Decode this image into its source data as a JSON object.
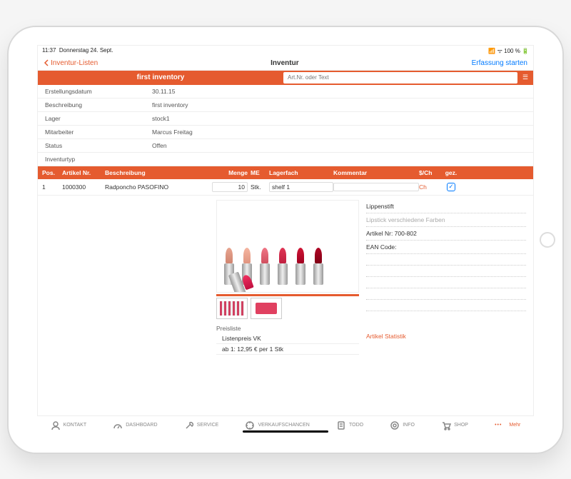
{
  "status_bar": {
    "time": "11:37",
    "date": "Donnerstag 24. Sept.",
    "battery": "100 %"
  },
  "nav": {
    "back": "Inventur-Listen",
    "title": "Inventur",
    "action": "Erfassung starten"
  },
  "title_row": {
    "label": "first inventory",
    "search_placeholder": "Art.Nr. oder Text"
  },
  "info": [
    {
      "label": "Erstellungsdatum",
      "value": "30.11.15"
    },
    {
      "label": "Beschreibung",
      "value": "first inventory"
    },
    {
      "label": "Lager",
      "value": "stock1"
    },
    {
      "label": "Mitarbeiter",
      "value": "Marcus Freitag"
    },
    {
      "label": "Status",
      "value": "Offen"
    },
    {
      "label": "Inventurtyp",
      "value": ""
    }
  ],
  "grid": {
    "headers": {
      "pos": "Pos.",
      "art": "Artikel Nr.",
      "desc": "Beschreibung",
      "menge": "Menge",
      "me": "ME",
      "lager": "Lagerfach",
      "komm": "Kommentar",
      "sch": "$/Ch",
      "gez": "gez."
    },
    "row": {
      "pos": "1",
      "art": "1000300",
      "desc": "Radponcho PASOFINO",
      "menge": "10",
      "me": "Stk.",
      "lager": "shelf 1",
      "komm": "",
      "sch": "Ch",
      "gez": true
    }
  },
  "detail": {
    "name": "Lippenstift",
    "sub": "Lipstick verschiedene Farben",
    "artnr": "Artikel Nr: 700-802",
    "ean": "EAN Code:",
    "stat_link": "Artikel Statistik",
    "pricelist": {
      "title": "Preisliste",
      "line1": "Listenpreis VK",
      "line2": "ab 1: 12,95 € per 1 Stk"
    }
  },
  "bottom_nav": [
    {
      "label": "KONTAKT",
      "icon": "contact"
    },
    {
      "label": "DASHBOARD",
      "icon": "dashboard"
    },
    {
      "label": "SERVICE",
      "icon": "service"
    },
    {
      "label": "VERKAUFSCHANCEN",
      "icon": "target"
    },
    {
      "label": "TODO",
      "icon": "todo"
    },
    {
      "label": "INFO",
      "icon": "info"
    },
    {
      "label": "SHOP",
      "icon": "shop"
    },
    {
      "label": "Mehr",
      "icon": "more",
      "active": true
    }
  ]
}
